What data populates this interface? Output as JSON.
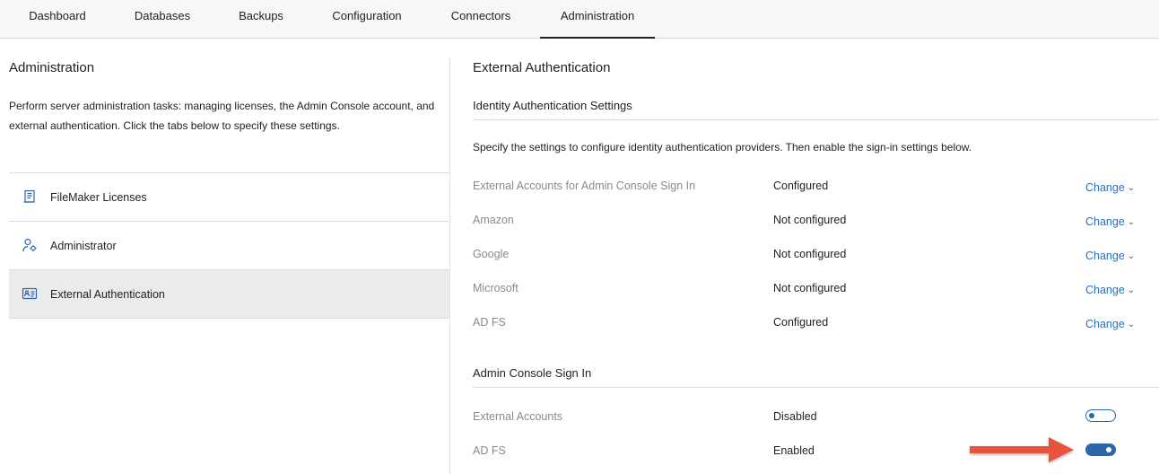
{
  "nav": {
    "tabs": [
      {
        "label": "Dashboard"
      },
      {
        "label": "Databases"
      },
      {
        "label": "Backups"
      },
      {
        "label": "Configuration"
      },
      {
        "label": "Connectors"
      },
      {
        "label": "Administration",
        "active": true
      }
    ]
  },
  "left": {
    "title": "Administration",
    "description": "Perform server administration tasks: managing licenses, the Admin Console account, and external authentication. Click the tabs below to specify these settings.",
    "items": [
      {
        "label": "FileMaker Licenses",
        "icon": "license-icon"
      },
      {
        "label": "Administrator",
        "icon": "admin-gear-icon"
      },
      {
        "label": "External Authentication",
        "icon": "id-card-icon",
        "selected": true
      }
    ]
  },
  "right": {
    "title": "External Authentication",
    "identity": {
      "heading": "Identity Authentication Settings",
      "description": "Specify the settings to configure identity authentication providers. Then enable the sign-in settings below.",
      "rows": [
        {
          "label": "External Accounts for Admin Console Sign In",
          "status": "Configured",
          "action": "Change"
        },
        {
          "label": "Amazon",
          "status": "Not configured",
          "action": "Change"
        },
        {
          "label": "Google",
          "status": "Not configured",
          "action": "Change"
        },
        {
          "label": "Microsoft",
          "status": "Not configured",
          "action": "Change"
        },
        {
          "label": "AD FS",
          "status": "Configured",
          "action": "Change"
        }
      ]
    },
    "signin": {
      "heading": "Admin Console Sign In",
      "rows": [
        {
          "label": "External Accounts",
          "status": "Disabled",
          "enabled": false
        },
        {
          "label": "AD FS",
          "status": "Enabled",
          "enabled": true
        }
      ]
    }
  },
  "colors": {
    "link": "#2a6fbf",
    "toggle": "#2d66ad",
    "annotation_arrow": "#e8533a",
    "selected_row": "#ebebeb"
  },
  "annotation": {
    "icon": "red-arrow-icon"
  }
}
